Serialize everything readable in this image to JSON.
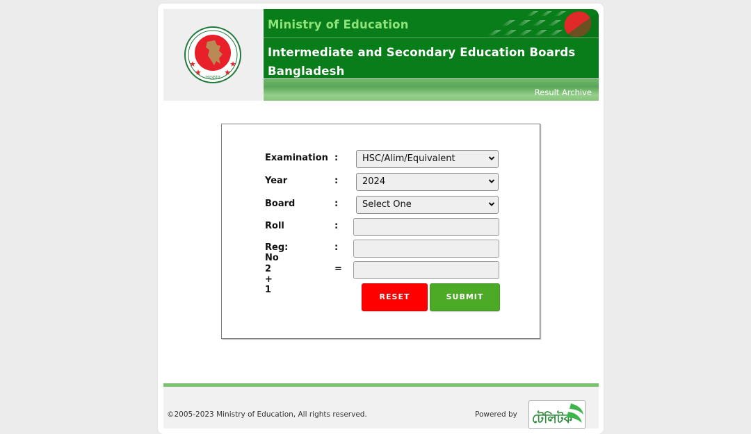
{
  "header": {
    "ministry": "Ministry of Education",
    "title_line1": "Intermediate and Secondary Education Boards",
    "title_line2": "Bangladesh",
    "archive_link": "Result Archive",
    "logo_name": "government-seal-logo"
  },
  "form": {
    "fields": [
      {
        "label": "Examination",
        "separator": ":",
        "type": "select",
        "value": "HSC/Alim/Equivalent"
      },
      {
        "label": "Year",
        "separator": ":",
        "type": "select",
        "value": "2024"
      },
      {
        "label": "Board",
        "separator": ":",
        "type": "select",
        "value": "Select One"
      },
      {
        "label": "Roll",
        "separator": ":",
        "type": "text",
        "value": ""
      },
      {
        "label": "Reg: No",
        "separator": ":",
        "type": "text",
        "value": ""
      },
      {
        "label": "2 + 1",
        "separator": "=",
        "type": "text",
        "value": ""
      }
    ],
    "reset_label": "RESET",
    "submit_label": "SUBMIT"
  },
  "footer": {
    "copyright": "©2005-2023 Ministry of Education, All rights reserved.",
    "powered_by": "Powered by",
    "sponsor_logo": "teletalk-logo"
  },
  "colors": {
    "banner_green": "#087d19",
    "ministry_text": "#8ee37a",
    "reset_red": "#ff0000",
    "submit_green": "#4daa26",
    "footer_bar": "#7cc36f"
  }
}
